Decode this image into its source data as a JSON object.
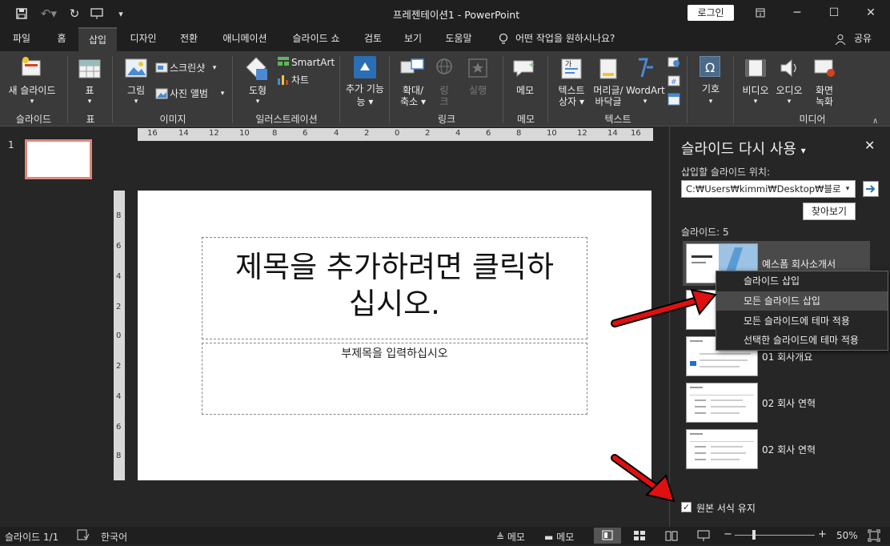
{
  "titlebar": {
    "title": "프레젠테이션1  -  PowerPoint",
    "login": "로그인",
    "customize": "▾"
  },
  "tabs": [
    "파일",
    "홈",
    "삽입",
    "디자인",
    "전환",
    "애니메이션",
    "슬라이드 쇼",
    "검토",
    "보기",
    "도움말"
  ],
  "tellme": "어떤 작업을 원하시나요?",
  "share": "공유",
  "ribbon": {
    "new_slide": "새 슬라이드",
    "table": "표",
    "picture": "그림",
    "screenshot": "스크린샷",
    "photo_album": "사진 앨범",
    "shapes": "도형",
    "smartart": "SmartArt",
    "chart": "차트",
    "addins": "추가 기능",
    "zoom1": "확대/",
    "zoom2": "축소",
    "link1": "링",
    "link2": "크",
    "action": "실행",
    "comment": "메모",
    "textbox1": "텍스트",
    "textbox2": "상자",
    "header1": "머리글/",
    "header2": "바닥글",
    "wordart": "WordArt",
    "symbol": "기호",
    "video": "비디오",
    "audio": "오디오",
    "rec1": "화면",
    "rec2": "녹화",
    "groups": [
      "슬라이드",
      "표",
      "이미지",
      "일러스트레이션",
      "링크",
      "메모",
      "텍스트",
      "미디어"
    ]
  },
  "slidepane": {
    "num": "1"
  },
  "slide": {
    "title1": "제목을 추가하려면 클릭하",
    "title2": "십시오.",
    "subtitle": "부제목을 입력하십시오"
  },
  "hruler": [
    "16",
    "14",
    "12",
    "10",
    "8",
    "6",
    "4",
    "2",
    "0",
    "2",
    "4",
    "6",
    "8",
    "10",
    "12",
    "14",
    "16"
  ],
  "vruler": [
    "8",
    "6",
    "4",
    "2",
    "0",
    "2",
    "4",
    "6",
    "8"
  ],
  "reuse": {
    "title": "슬라이드 다시 사용",
    "insert_from": "삽입할 슬라이드 위치:",
    "path": "C:₩Users₩kimmi₩Desktop₩블로그",
    "browse": "찾아보기",
    "count": "슬라이드: 5",
    "slides": [
      "예스폼 회사소개서",
      "01 회사개요",
      "02 회사 연혁",
      "02 회사 연혁"
    ],
    "keep_format": "원본 서식 유지"
  },
  "context_menu": [
    "슬라이드 삽입",
    "모든 슬라이드 삽입",
    "모든 슬라이드에 테마 적용",
    "선택한 슬라이드에 테마 적용"
  ],
  "status": {
    "slide": "슬라이드 1/1",
    "lang": "한국어",
    "notes": "메모",
    "comments": "메모",
    "zoom": "50%"
  },
  "colors": {
    "accent": "#d04423",
    "arrow": "#e01010"
  }
}
